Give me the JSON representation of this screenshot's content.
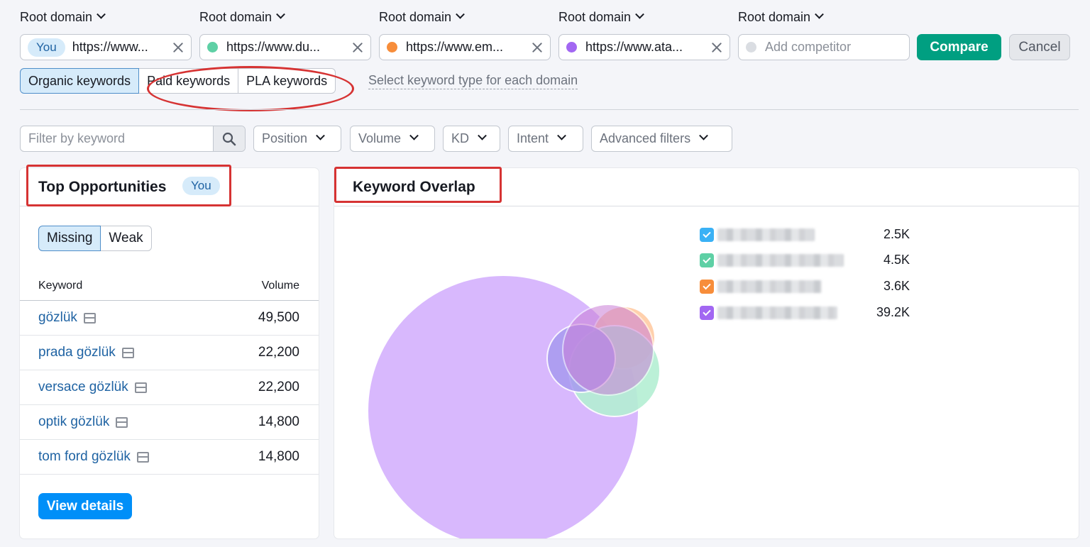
{
  "domains": [
    {
      "label": "Root domain",
      "badge": "You",
      "url": "https://www...",
      "color": null
    },
    {
      "label": "Root domain",
      "url": "https://www.du...",
      "color": "#5ed0a5"
    },
    {
      "label": "Root domain",
      "url": "https://www.em...",
      "color": "#f78d3a"
    },
    {
      "label": "Root domain",
      "url": "https://www.ata...",
      "color": "#a267f2"
    },
    {
      "label": "Root domain",
      "placeholder": "Add competitor",
      "color": "#dadde2"
    }
  ],
  "actions": {
    "compare": "Compare",
    "cancel": "Cancel"
  },
  "keyword_types": {
    "items": [
      "Organic keywords",
      "Paid keywords",
      "PLA keywords"
    ],
    "active": "Organic keywords",
    "hint": "Select keyword type for each domain"
  },
  "filters": {
    "search_placeholder": "Filter by keyword",
    "dropdowns": [
      "Position",
      "Volume",
      "KD",
      "Intent",
      "Advanced filters"
    ]
  },
  "top_opportunities": {
    "title": "Top Opportunities",
    "badge": "You",
    "segments": [
      "Missing",
      "Weak"
    ],
    "active_segment": "Missing",
    "columns": [
      "Keyword",
      "Volume"
    ],
    "rows": [
      {
        "keyword": "gözlük",
        "volume": "49,500"
      },
      {
        "keyword": "prada gözlük",
        "volume": "22,200"
      },
      {
        "keyword": "versace gözlük",
        "volume": "22,200"
      },
      {
        "keyword": "optik gözlük",
        "volume": "14,800"
      },
      {
        "keyword": "tom ford gözlük",
        "volume": "14,800"
      }
    ],
    "button": "View details"
  },
  "keyword_overlap": {
    "title": "Keyword Overlap",
    "legend": [
      {
        "value": "2.5K",
        "color": "#3ab1f5"
      },
      {
        "value": "4.5K",
        "color": "#5ed0a5"
      },
      {
        "value": "3.6K",
        "color": "#f78d3a"
      },
      {
        "value": "39.2K",
        "color": "#a267f2"
      }
    ]
  }
}
